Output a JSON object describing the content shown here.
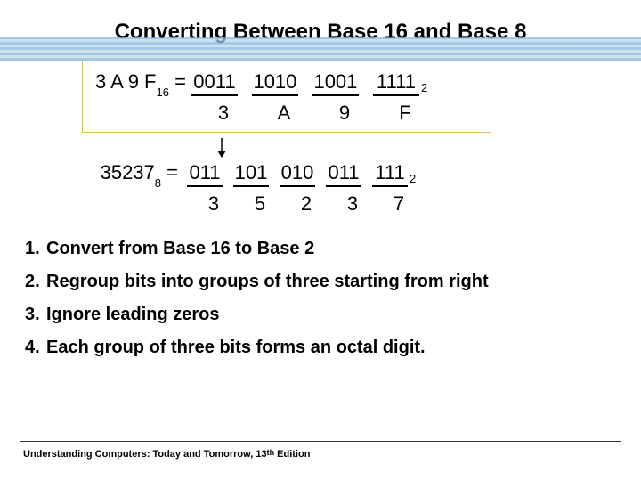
{
  "title": "Converting Between Base 16 and Base 8",
  "hex": {
    "lhs_main": "3 A 9 F",
    "lhs_sub": "16",
    "equals": " = ",
    "groups": [
      "0011",
      "1010",
      "1001",
      "1111"
    ],
    "trailing_sub": "2",
    "labels": [
      "3",
      "A",
      "9",
      "F"
    ]
  },
  "octal": {
    "lhs_main": "35237",
    "lhs_sub": "8",
    "equals": " = ",
    "groups": [
      "011",
      "101",
      "010",
      "011",
      "111"
    ],
    "trailing_sub": "2",
    "labels": [
      "3",
      "5",
      "2",
      "3",
      "7"
    ]
  },
  "steps": [
    "Convert from Base 16 to Base 2",
    "Regroup bits into groups of three starting from right",
    "Ignore leading zeros",
    "Each group of three bits forms an octal digit."
  ],
  "step_nums": [
    "1.",
    "2.",
    "3.",
    "4."
  ],
  "footer": {
    "prefix": "Understanding Computers: Today and Tomorrow, 13",
    "ord": "th",
    "suffix": " Edition"
  }
}
